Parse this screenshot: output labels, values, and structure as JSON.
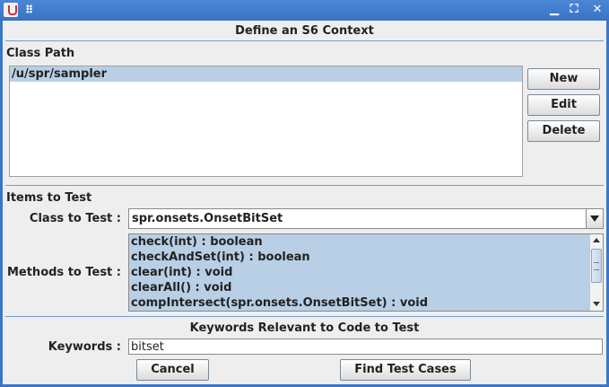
{
  "titlebar": {
    "icons": [
      "java-icon",
      "grip-icon",
      "minimize-icon",
      "maximize-icon",
      "close-icon"
    ],
    "minimize_glyph": "▁",
    "maximize_glyph": "⛶",
    "close_glyph": "✕",
    "grip_glyph": "⠿"
  },
  "dialog": {
    "title": "Define an S6 Context"
  },
  "class_path": {
    "label": "Class Path",
    "items": [
      "/u/spr/sampler"
    ],
    "selected_index": 0,
    "buttons": {
      "new": "New",
      "edit": "Edit",
      "delete": "Delete"
    }
  },
  "items_to_test": {
    "label": "Items to Test",
    "class_label": "Class to Test :",
    "class_value": "spr.onsets.OnsetBitSet",
    "methods_label": "Methods to Test :",
    "methods": [
      "check(int) : boolean",
      "checkAndSet(int) : boolean",
      "clear(int) : void",
      "clearAll() : void",
      "compIntersect(spr.onsets.OnsetBitSet) : void"
    ]
  },
  "keywords": {
    "header": "Keywords Relevant to Code to Test",
    "label": "Keywords :",
    "value": "bitset"
  },
  "actions": {
    "cancel": "Cancel",
    "find": "Find Test Cases"
  },
  "colors": {
    "titlebar": "#3a73c4",
    "selection": "#b8cfe5",
    "panel": "#eeeeee"
  }
}
